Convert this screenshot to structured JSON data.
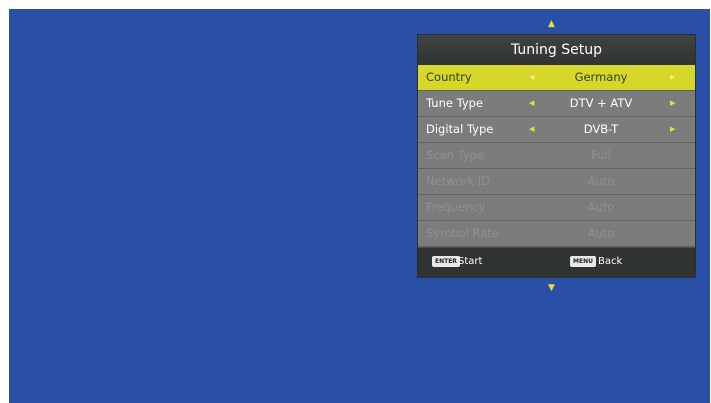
{
  "panel": {
    "title": "Tuning Setup"
  },
  "nav": {
    "up_arrow": "▲",
    "down_arrow": "▼",
    "left_arrow": "◀",
    "right_arrow": "▶"
  },
  "rows": [
    {
      "label": "Country",
      "value": "Germany",
      "selected": true,
      "enabled": true
    },
    {
      "label": "Tune Type",
      "value": "DTV + ATV",
      "selected": false,
      "enabled": true
    },
    {
      "label": "Digital Type",
      "value": "DVB-T",
      "selected": false,
      "enabled": true
    },
    {
      "label": "Scan Type",
      "value": "Full",
      "selected": false,
      "enabled": false
    },
    {
      "label": "Network ID",
      "value": "Auto",
      "selected": false,
      "enabled": false
    },
    {
      "label": "Frequency",
      "value": "Auto",
      "selected": false,
      "enabled": false
    },
    {
      "label": "Symbol Rate",
      "value": "Auto",
      "selected": false,
      "enabled": false
    }
  ],
  "footer": {
    "enter_key": "ENTER",
    "start_label": "Start",
    "menu_key": "MENU",
    "back_label": "Back"
  },
  "colors": {
    "background": "#2a4fa6",
    "highlight": "#d5d82b",
    "accent": "#e6e22c"
  }
}
